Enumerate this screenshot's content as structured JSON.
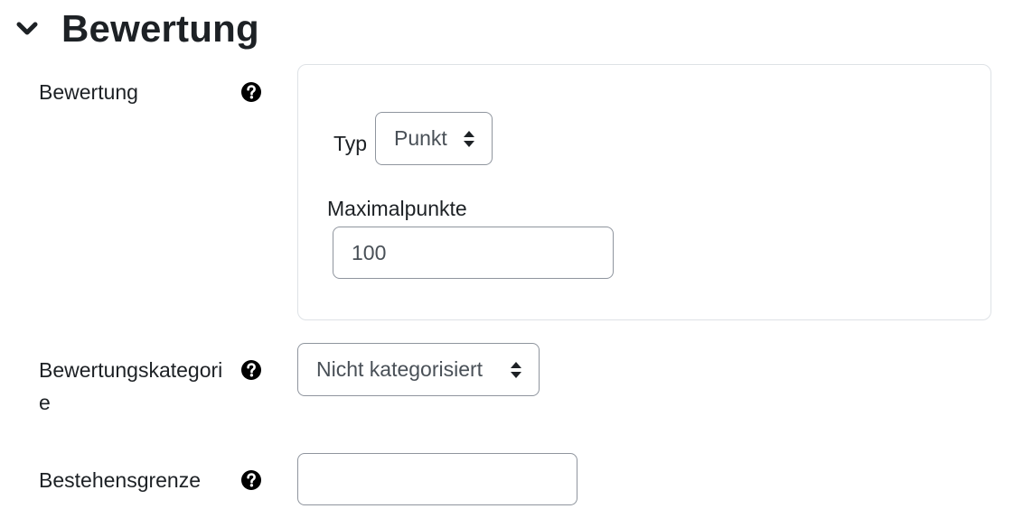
{
  "section": {
    "title": "Bewertung",
    "toggle_icon": "chevron-down-icon"
  },
  "grade": {
    "label": "Bewertung",
    "help_icon": "question-circle-icon",
    "type_label": "Typ",
    "type_value": "Punkt",
    "max_label": "Maximalpunkte",
    "max_value": "100"
  },
  "category": {
    "label": "Bewertungskategorie",
    "help_icon": "question-circle-icon",
    "value": "Nicht kategorisiert"
  },
  "pass": {
    "label": "Bestehensgrenze",
    "help_icon": "question-circle-icon",
    "value": ""
  },
  "colors": {
    "text": "#1d2125",
    "input_text": "#495057",
    "input_border": "#8f959e",
    "group_border": "#dee2e6"
  }
}
